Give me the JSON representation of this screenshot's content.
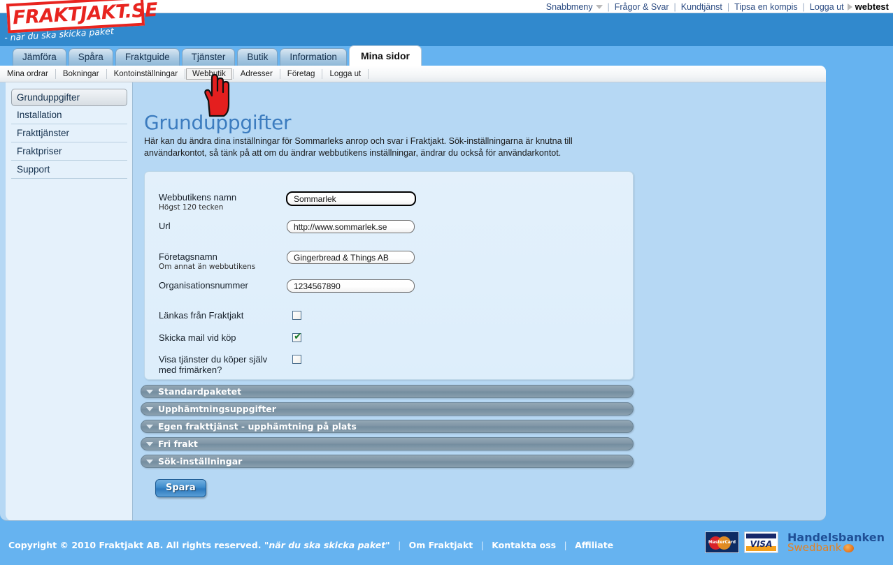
{
  "topbar": {
    "items": [
      {
        "label": "Snabbmeny",
        "icon": "chevron-down-icon"
      },
      {
        "label": "Frågor & Svar"
      },
      {
        "label": "Kundtjänst"
      },
      {
        "label": "Tipsa en kompis"
      },
      {
        "label": "Logga ut",
        "icon": "triangle-right-icon"
      }
    ],
    "username": "webtest"
  },
  "logo": {
    "brand": "FRAKTJAKT.SE",
    "tagline": "- när du ska skicka paket",
    "brand_color": "#e8241f"
  },
  "tabs": [
    {
      "label": "Jämföra",
      "active": false
    },
    {
      "label": "Spåra",
      "active": false
    },
    {
      "label": "Fraktguide",
      "active": false
    },
    {
      "label": "Tjänster",
      "active": false
    },
    {
      "label": "Butik",
      "active": false
    },
    {
      "label": "Information",
      "active": false
    },
    {
      "label": "Mina sidor",
      "active": true
    }
  ],
  "subnav": [
    {
      "label": "Mina ordrar",
      "selected": false
    },
    {
      "label": "Bokningar",
      "selected": false
    },
    {
      "label": "Kontoinställningar",
      "selected": false
    },
    {
      "label": "Webbutik",
      "selected": true
    },
    {
      "label": "Adresser",
      "selected": false
    },
    {
      "label": "Företag",
      "selected": false
    },
    {
      "label": "Logga ut",
      "selected": false
    }
  ],
  "sidebar": {
    "items": [
      {
        "label": "Grunduppgifter",
        "active": true
      },
      {
        "label": "Installation",
        "active": false
      },
      {
        "label": "Frakttjänster",
        "active": false
      },
      {
        "label": "Fraktpriser",
        "active": false
      },
      {
        "label": "Support",
        "active": false
      }
    ]
  },
  "main": {
    "title": "Grunduppgifter",
    "intro": "Här kan du ändra dina inställningar för Sommarleks anrop och svar i Fraktjakt. Sök-inställningarna är knutna till användarkontot, så tänk på att om du ändrar webbutikens inställningar, ändrar du också för användarkontot.",
    "fields": [
      {
        "label": "Webbutikens namn",
        "hint": "Högst 120 tecken",
        "value": "Sommarlek",
        "focused": true
      },
      {
        "label": "Url",
        "hint": "",
        "value": "http://www.sommarlek.se",
        "focused": false
      },
      {
        "label": "Företagsnamn",
        "hint": "Om annat än webbutikens",
        "value": "Gingerbread & Things AB",
        "focused": false
      },
      {
        "label": "Organisationsnummer",
        "hint": "",
        "value": "1234567890",
        "focused": false
      }
    ],
    "checkboxes": [
      {
        "label": "Länkas från Fraktjakt",
        "checked": false
      },
      {
        "label": "Skicka mail vid köp",
        "checked": true
      },
      {
        "label": "Visa tjänster du köper själv med frimärken?",
        "checked": false
      }
    ],
    "accordion": [
      {
        "label": "Standardpaketet"
      },
      {
        "label": "Upphämtningsuppgifter"
      },
      {
        "label": "Egen frakttjänst - upphämtning på plats"
      },
      {
        "label": "Fri frakt"
      },
      {
        "label": "Sök-inställningar"
      }
    ],
    "save_label": "Spara"
  },
  "footer": {
    "copyright": "Copyright © 2010 Fraktjakt AB.  All rights reserved.",
    "slogan": "\"när du ska skicka paket\"",
    "links": [
      "Om Fraktjakt",
      "Kontakta oss",
      "Affiliate"
    ],
    "payment_logos": [
      "MasterCard",
      "VISA"
    ],
    "bank_primary": "Handelsbanken",
    "bank_secondary": "Swedbank"
  },
  "colors": {
    "page_blue": "#66b3f0",
    "header_blue": "#3189cd",
    "content_blue": "#b6d8f4",
    "title_blue": "#3c7cbf",
    "accordion_grey": "#7f95a6"
  }
}
